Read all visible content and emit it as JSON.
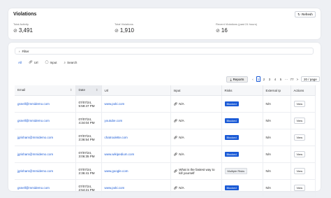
{
  "header": {
    "title": "Violations",
    "refresh_label": "Refresh"
  },
  "stats": [
    {
      "label": "Total Activity",
      "value": "3,491"
    },
    {
      "label": "Total Violations",
      "value": "1,910"
    },
    {
      "label": "Recent Violations (past 24 hours)",
      "value": "16"
    }
  ],
  "filter": {
    "label": "Filter"
  },
  "tabs": [
    {
      "label": "All",
      "icon": ""
    },
    {
      "label": "Url",
      "icon": "link-icon"
    },
    {
      "label": "Input",
      "icon": "chat-icon"
    },
    {
      "label": "Search",
      "icon": "search-icon"
    }
  ],
  "toolbar": {
    "reports_label": "Reports",
    "pages": [
      "1",
      "2",
      "3",
      "4",
      "5",
      "···",
      "77",
      ">"
    ],
    "page_size": "20 / page"
  },
  "table": {
    "columns": [
      "Email",
      "Date",
      "Url",
      "Input",
      "Risks",
      "External Ip",
      "Actions"
    ],
    "rows": [
      {
        "email": "gsnell@mmidemo.com",
        "date": "07/07/24, 5:59:47 PM",
        "url": "www.poki.com",
        "input": "N/A",
        "risk": "Blocked",
        "ip": "N/A",
        "action": "View"
      },
      {
        "email": "gsnell@mmidemo.com",
        "date": "07/07/24, 4:34:04 PM",
        "url": "youtube.com",
        "input": "N/A",
        "risk": "Blocked",
        "ip": "N/A",
        "action": "View"
      },
      {
        "email": "jgrisham@mmidemo.com",
        "date": "07/07/24, 3:36:54 PM",
        "url": "chatroulette.com",
        "input": "N/A",
        "risk": "Blocked",
        "ip": "N/A",
        "action": "View"
      },
      {
        "email": "jgrisham@mmidemo.com",
        "date": "07/07/24, 3:06:35 PM",
        "url": "www.wikipedium.com",
        "input": "N/A",
        "risk": "Blocked",
        "ip": "N/A",
        "action": "View"
      },
      {
        "email": "jgrisham@mmidemo.com",
        "date": "07/07/24, 2:36:41 PM",
        "url": "www.google.com",
        "input": "What is the fastest way to kill yourself",
        "risk": "Multiple Risks",
        "ip": "N/A",
        "action": "View"
      },
      {
        "email": "gsnell@mmidemo.com",
        "date": "07/07/24, 2:54:21 PM",
        "url": "www.poki.com",
        "input": "N/A",
        "risk": "Blocked",
        "ip": "N/A",
        "action": "View"
      }
    ]
  },
  "colors": {
    "accent": "#1a5ad6",
    "page_bg": "#eef0f4"
  }
}
